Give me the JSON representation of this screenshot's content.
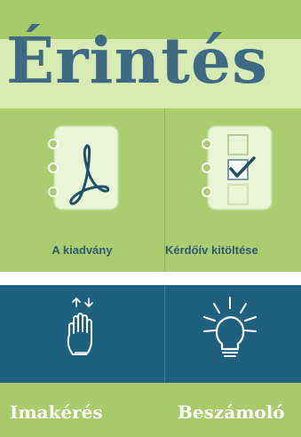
{
  "header": {
    "title": "Érintés"
  },
  "tiles_top": [
    {
      "label": "A kiadvány",
      "icon": "pdf-document-icon"
    },
    {
      "label": "Kérdőív kitöltése",
      "icon": "checklist-icon"
    }
  ],
  "tiles_bottom": [
    {
      "label": "Imakérés",
      "icon": "raised-hand-icon"
    },
    {
      "label": "Beszámoló",
      "icon": "lightbulb-icon"
    }
  ],
  "colors": {
    "header_bg": "#d8eab4",
    "header_band": "#a6cc6a",
    "title": "#3f6a84",
    "green_tile": "#a9cd6f",
    "blue_tile": "#20607f",
    "top_label": "#2f5a72",
    "bottom_label": "#ffffff"
  }
}
